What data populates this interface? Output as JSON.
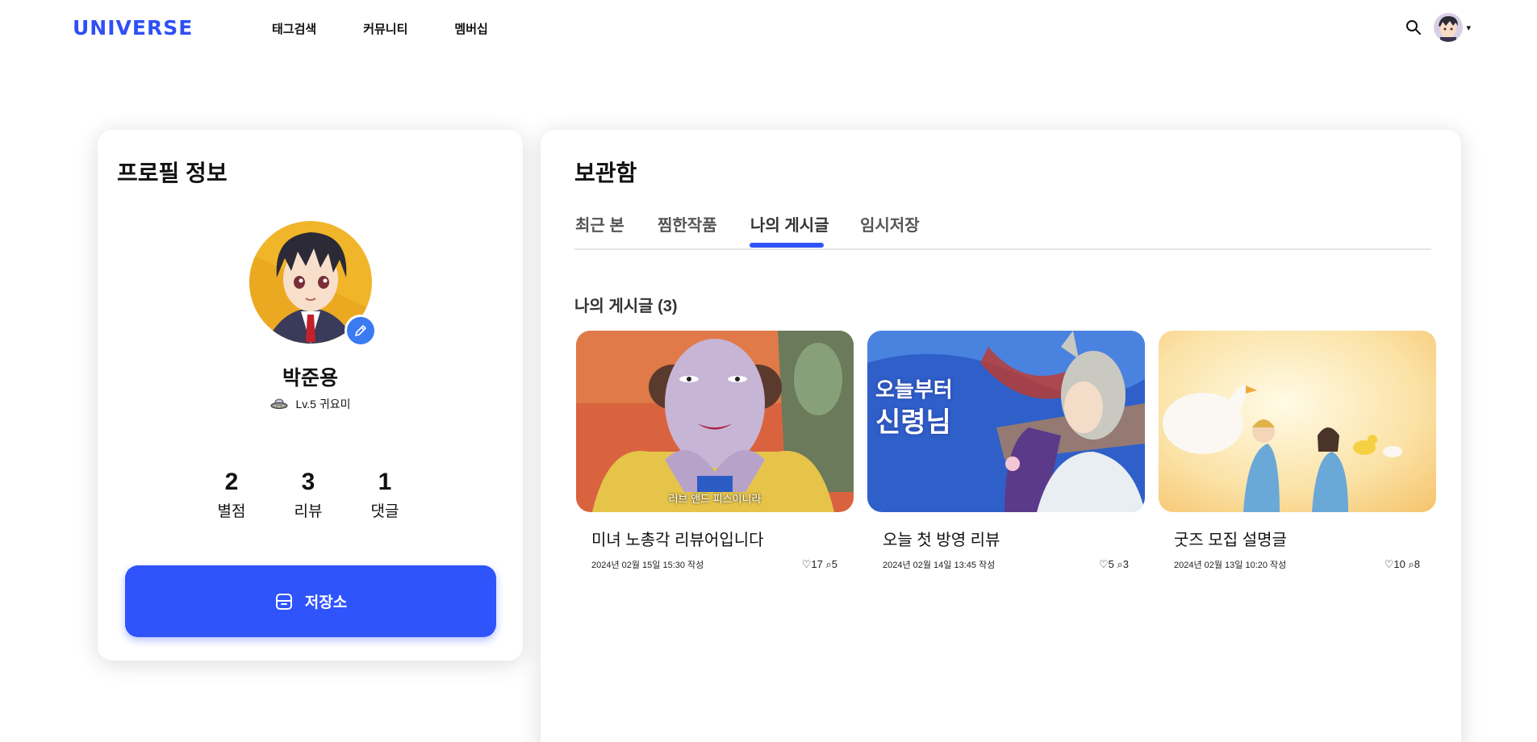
{
  "header": {
    "logo": "UNIVERSE",
    "nav": [
      "태그검색",
      "커뮤니티",
      "멤버십"
    ],
    "search_icon": "search-icon",
    "menu_caret": "▾"
  },
  "profile": {
    "title": "프로필 정보",
    "name": "박준용",
    "level": "Lv.5 귀요미",
    "stats": [
      {
        "value": "2",
        "label": "별점"
      },
      {
        "value": "3",
        "label": "리뷰"
      },
      {
        "value": "1",
        "label": "댓글"
      }
    ],
    "storage_button": "저장소"
  },
  "storage": {
    "title": "보관함",
    "tabs": [
      "최근 본",
      "찜한작품",
      "나의 게시글",
      "임시저장"
    ],
    "active_tab": "나의 게시글",
    "section_title": "나의 게시글 (3)",
    "posts": [
      {
        "title": "미녀 노총각 리뷰어입니다",
        "date": "2024년 02월 15일 15:30 작성",
        "likes": "♡17",
        "comments": "⌕5",
        "subtitle": "러브 앤드 피스이니라"
      },
      {
        "title": "오늘 첫 방영 리뷰",
        "date": "2024년 02월 14일 13:45 작성",
        "likes": "♡5",
        "comments": "⌕3",
        "thumb_text": [
          "오늘부터",
          "신령님"
        ]
      },
      {
        "title": "굿즈 모집 설명글",
        "date": "2024년 02월 13일 10:20 작성",
        "likes": "♡10",
        "comments": "⌕8"
      }
    ]
  },
  "colors": {
    "brand": "#2f4ff6",
    "button": "#2f54fc",
    "edit_badge": "#3b7bf2"
  }
}
